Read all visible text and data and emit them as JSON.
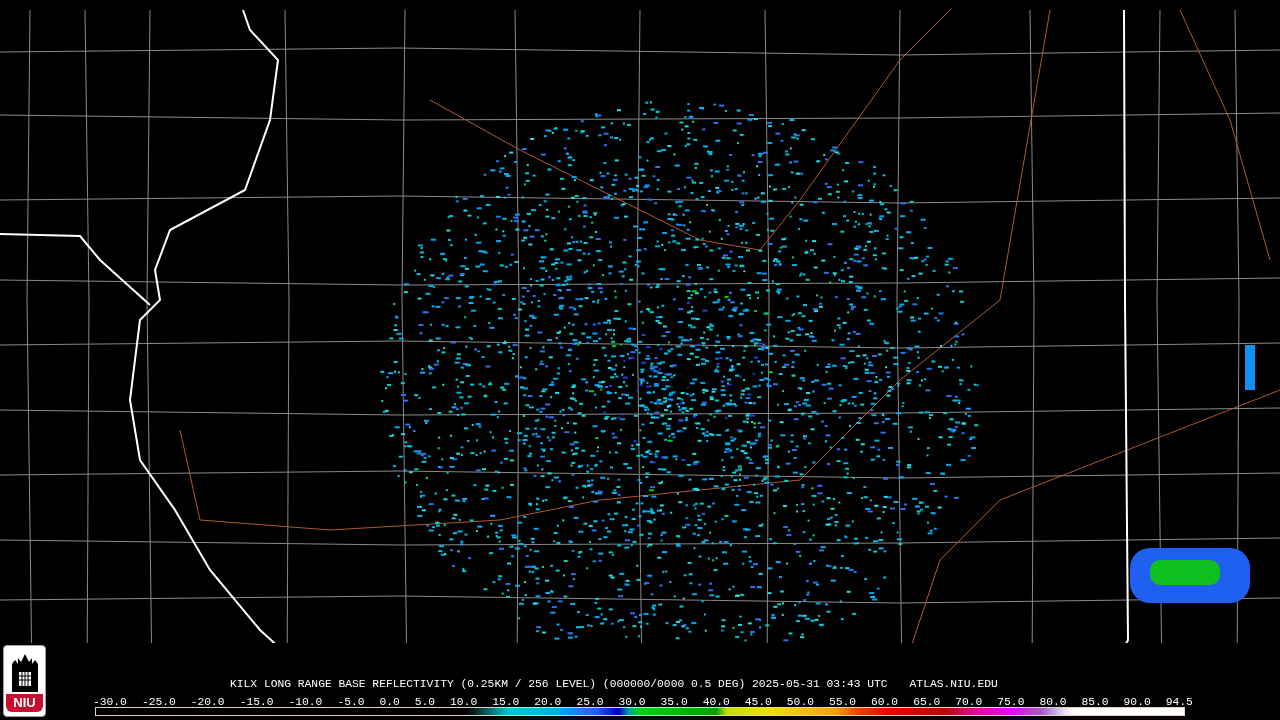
{
  "product_title": "KILX LONG RANGE BASE REFLECTIVITY (0.25KM / 256 LEVEL) (000000/0000 0.5 DEG) 2025-05-31 03:43 UTC",
  "site": "ATLAS.NIU.EDU",
  "logo": {
    "text": "NIU"
  },
  "color_scale": {
    "labels": [
      "-30.0",
      "-25.0",
      "-20.0",
      "-15.0",
      "-10.0",
      "-5.0",
      "0.0",
      "5.0",
      "10.0",
      "15.0",
      "20.0",
      "25.0",
      "30.0",
      "35.0",
      "40.0",
      "45.0",
      "50.0",
      "55.0",
      "60.0",
      "65.0",
      "70.0",
      "75.0",
      "80.0",
      "85.0",
      "90.0",
      "94.5"
    ]
  }
}
